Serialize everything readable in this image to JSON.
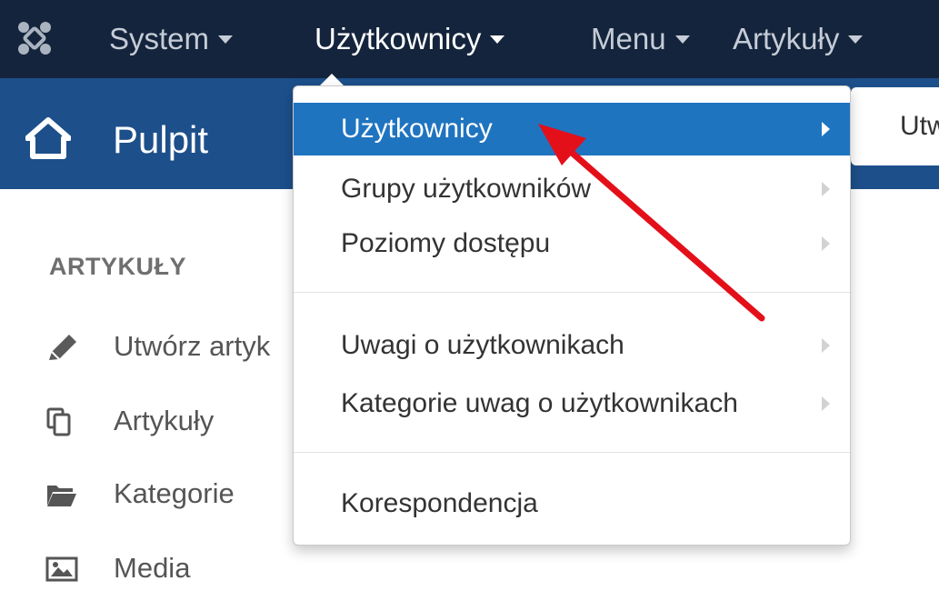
{
  "navbar": {
    "logo_icon": "joomla-logo-icon",
    "items": [
      {
        "label": "System"
      },
      {
        "label": "Użytkownicy",
        "active": true
      },
      {
        "label": "Menu"
      },
      {
        "label": "Artykuły"
      }
    ]
  },
  "header": {
    "icon": "home-icon",
    "title": "Pulpit",
    "button_label": "Utw"
  },
  "sidebar": {
    "heading": "ARTYKUŁY",
    "items": [
      {
        "label": "Utwórz artyk",
        "icon": "pencil-icon"
      },
      {
        "label": "Artykuły",
        "icon": "copy-icon"
      },
      {
        "label": "Kategorie",
        "icon": "folder-icon"
      },
      {
        "label": "Media",
        "icon": "image-icon"
      }
    ]
  },
  "dropdown": {
    "items": [
      {
        "label": "Użytkownicy",
        "active": true,
        "submenu": true
      },
      {
        "label": "Grupy użytkowników",
        "submenu": true
      },
      {
        "label": "Poziomy dostępu",
        "submenu": true
      },
      {
        "label": "Uwagi o użytkownikach",
        "submenu": true
      },
      {
        "label": "Kategorie uwag o użytkownikach",
        "submenu": true
      },
      {
        "label": "Korespondencja",
        "submenu": false
      }
    ]
  },
  "colors": {
    "navbar_bg": "#14243c",
    "header_bg": "#1d4f8a",
    "active_item_bg": "#1f74c0",
    "annotation_arrow": "#e3101a"
  }
}
